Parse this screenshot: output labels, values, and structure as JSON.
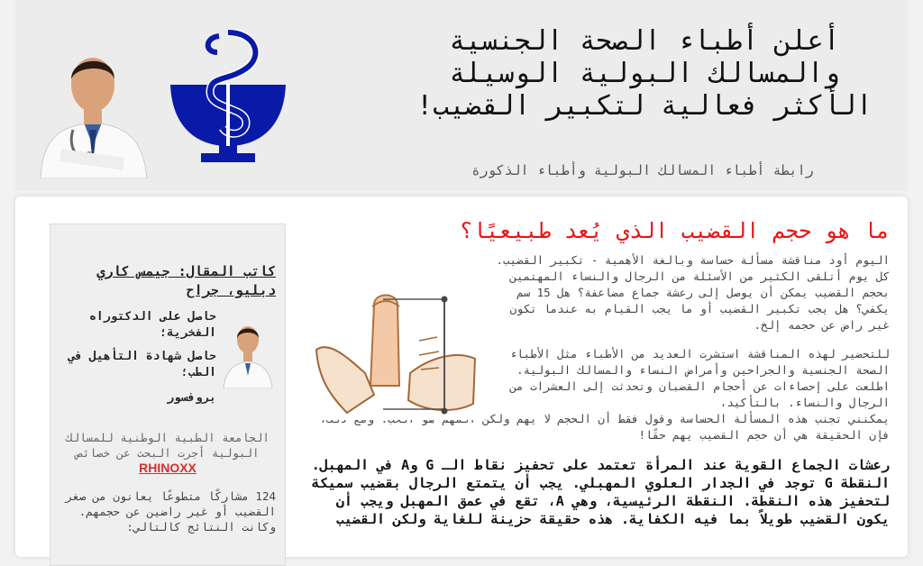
{
  "header": {
    "title": "أعلن أطباء الصحة الجنسية والمسالك البولية الوسيلة الأكثر فعالية لتكبير القضيب!",
    "subtitle": "رابطة أطباء المسالك البولية وأطباء الذكورة"
  },
  "sidebar": {
    "author_title": "كاتب المقال: جيمس كاري دبليو، جراح",
    "credentials": [
      "حاصل على الدكتوراه الفخرية؛",
      "حاصل شهادة التأهيل في الطب؛",
      "بروفسور"
    ],
    "institution_text": "الجامعة الطبية الوطنية للمسالك البولية أجرت البحث عن خصائص",
    "brand": "RHINOXX",
    "stat_text": "124 مشاركًا متطوعًا يعانون من صغر القضيب أو غير راضين عن حجمهم. وكانت النتائج كالتالي:"
  },
  "article": {
    "title": "ما هو حجم القضيب الذي يُعد طبيعيًا؟",
    "p1": "اليوم أود مناقشة مسألة حساسة وبالغة الأهمية - تكبير القضيب. كل يوم أتلقى الكثير من الأسئلة من الرجال والنساء المهتمين بحجم القضيب يمكن أن يوصل إلى رعشة جماع مضاعفة؟ هل 15 سم يكفي؟ هل يجب تكبير القضيب أو ما يجب القيام به عندما تكون غير راض عن حجمه إلخ.",
    "p2_wrap": "للتحضير لهذه المناقشة استشرت العديد من الأطباء مثل الأطباء الصحة الجنسية والجراحين وأمراض النساء والمسالك البولية. اطلعت على إحصاءات عن أحجام القضبان وتحدثت إلى العشرات من الرجال والنساء. بالتأكيد،",
    "p2_full": "يمكنني تجنب هذه المسألة الحساسة وقول فقط أن الحجم لا يهم ولكن المهم هو الحب. ومع ذلك، فإن الحقيقة هي أن حجم القضيب يهم حقًا!",
    "p3": "رعشات الجماع القوية عند المرأة تعتمد على تحفيز نقاط الـ G وA في المهبل. النقطة G توجد في الجدار العلوي المهبلي. يجب أن يتمتع الرجال بقضيب سميكة لتحفيز هذه النقطة. النقطة الرئيسية، وهي A، تقع في عمق المهبل ويجب أن يكون القضيب طويلاً بما فيه الكفاية. هذه حقيقة حزينة للغاية ولكن القضيب"
  },
  "colors": {
    "accent_red": "#e11111",
    "logo_blue": "#0a1aa8",
    "brand_red": "#d32f2f"
  },
  "icons": [
    "doctor-photo",
    "pharmacy-snake-bowl-logo",
    "measuring-illustration"
  ]
}
